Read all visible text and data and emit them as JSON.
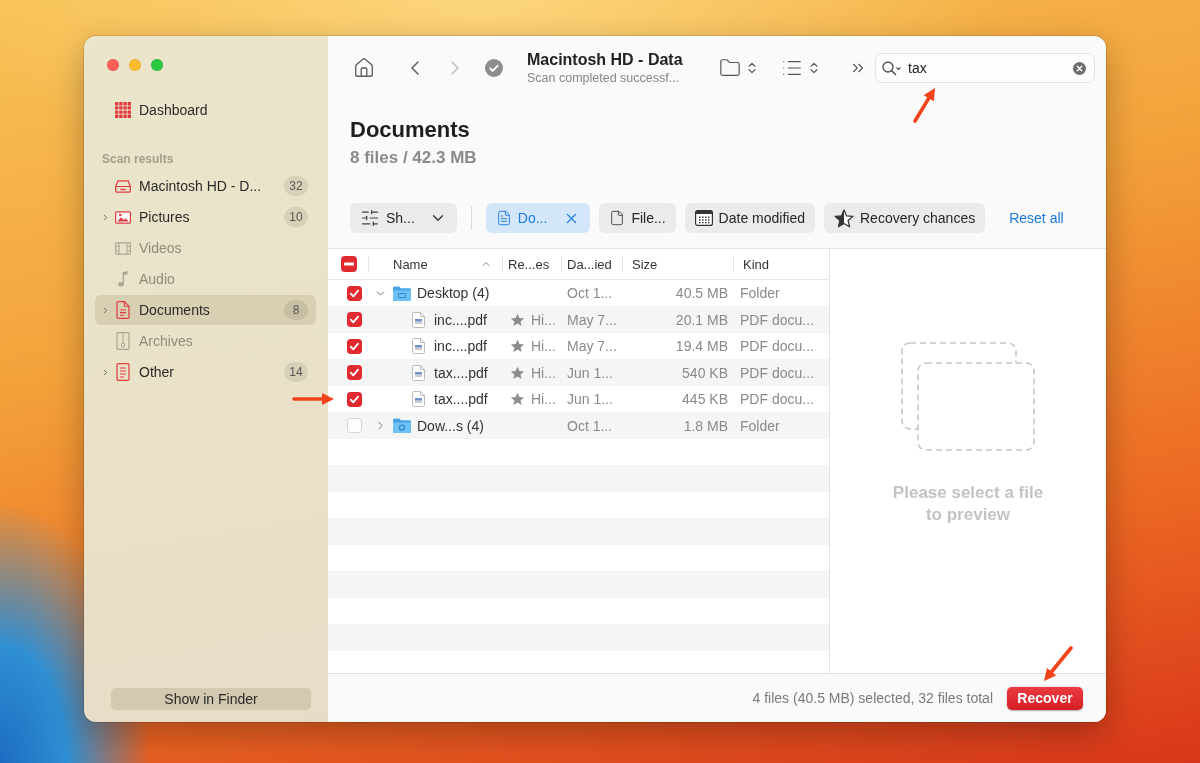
{
  "sidebar": {
    "dashboard": "Dashboard",
    "section_title": "Scan results",
    "items": [
      {
        "kind": "drive",
        "label": "Macintosh HD - D...",
        "count": "32",
        "expandable": false,
        "disabled": false,
        "selected": false
      },
      {
        "kind": "pictures",
        "label": "Pictures",
        "count": "10",
        "expandable": true,
        "disabled": false,
        "selected": false
      },
      {
        "kind": "videos",
        "label": "Videos",
        "expandable": false,
        "disabled": true,
        "selected": false
      },
      {
        "kind": "audio",
        "label": "Audio",
        "expandable": false,
        "disabled": true,
        "selected": false
      },
      {
        "kind": "documents",
        "label": "Documents",
        "count": "8",
        "expandable": true,
        "disabled": false,
        "selected": true
      },
      {
        "kind": "archives",
        "label": "Archives",
        "expandable": false,
        "disabled": true,
        "selected": false
      },
      {
        "kind": "other",
        "label": "Other",
        "count": "14",
        "expandable": true,
        "disabled": false,
        "selected": false
      }
    ],
    "footer_button": "Show in Finder"
  },
  "toolbar": {
    "nav": [
      {
        "kind": "home",
        "disabled": false
      },
      {
        "kind": "back",
        "disabled": false
      },
      {
        "kind": "forward",
        "disabled": true
      }
    ],
    "title": "Macintosh HD - Data",
    "subtitle": "Scan completed successf...",
    "search": {
      "value": "tax"
    }
  },
  "header": {
    "title": "Documents",
    "subtitle": "8 files / 42.3 MB"
  },
  "filters": {
    "chips": [
      {
        "kind": "show",
        "label": "Sh...",
        "selected": false
      },
      {
        "kind": "document",
        "label": "Do...",
        "selected": true
      },
      {
        "kind": "file",
        "label": "File...",
        "selected": false
      },
      {
        "kind": "date",
        "label": "Date modified",
        "selected": false
      },
      {
        "kind": "recovery",
        "label": "Recovery chances",
        "selected": false
      }
    ],
    "reset": "Reset all"
  },
  "table": {
    "select_all": {
      "checked": true,
      "mixed": true
    },
    "columns": [
      {
        "label": "Name",
        "sorted": true
      },
      {
        "label": "Re...es",
        "sorted": false
      },
      {
        "label": "Da...ied",
        "sorted": false
      },
      {
        "label": "Size",
        "sorted": false
      },
      {
        "label": "Kind",
        "sorted": false
      }
    ],
    "rows": [
      {
        "kind": "desktop",
        "checked": true,
        "expanded": true,
        "name": "Desktop (4)",
        "column_4": "Oct 1...",
        "size": "40.5 MB",
        "kind_label": "Folder",
        "children": [
          {
            "kind": "pdf",
            "checked": true,
            "name": "inc....pdf",
            "column_3": "Hi...",
            "column_4": "May 7...",
            "size": "20.1 MB",
            "kind_label": "PDF docu..."
          },
          {
            "kind": "pdf",
            "checked": true,
            "name": "inc....pdf",
            "column_3": "Hi...",
            "column_4": "May 7...",
            "size": "19.4 MB",
            "kind_label": "PDF docu..."
          },
          {
            "kind": "pdf",
            "checked": true,
            "name": "tax....pdf",
            "column_3": "Hi...",
            "column_4": "Jun 1...",
            "size": "540 KB",
            "kind_label": "PDF docu..."
          },
          {
            "kind": "pdf",
            "checked": true,
            "name": "tax....pdf",
            "column_3": "Hi...",
            "column_4": "Jun 1...",
            "size": "445 KB",
            "kind_label": "PDF docu..."
          }
        ]
      },
      {
        "kind": "downloads",
        "checked": false,
        "expanded": false,
        "name": "Dow...s (4)",
        "column_4": "Oct 1...",
        "size": "1.8 MB",
        "kind_label": "Folder"
      }
    ]
  },
  "preview": {
    "message": "Please select a file\nto preview"
  },
  "status_bar": {
    "summary": "4 files (40.5 MB) selected, 32 files total",
    "button": "Recover"
  }
}
